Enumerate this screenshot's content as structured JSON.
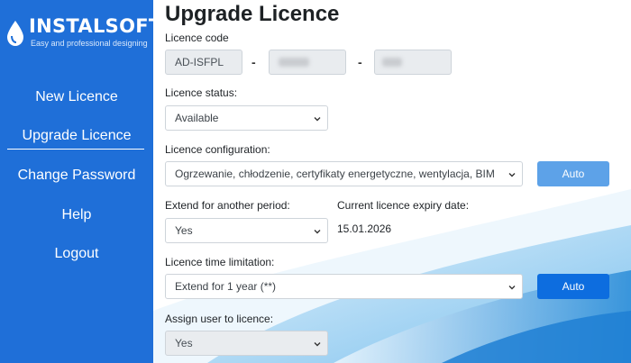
{
  "logo": {
    "title": "INSTALSOFT",
    "subtitle": "Easy and professional designing"
  },
  "sidebar": {
    "items": [
      {
        "label": "New Licence"
      },
      {
        "label": "Upgrade Licence"
      },
      {
        "label": "Change Password"
      },
      {
        "label": "Help"
      },
      {
        "label": "Logout"
      }
    ]
  },
  "page": {
    "title": "Upgrade Licence"
  },
  "licence_code": {
    "label": "Licence code",
    "part1": "AD-ISFPL",
    "separator": "-"
  },
  "licence_status": {
    "label": "Licence status:",
    "value": "Available"
  },
  "licence_configuration": {
    "label": "Licence configuration:",
    "value": "Ogrzewanie, chłodzenie, certyfikaty energetyczne, wentylacja, BIM",
    "button": "Auto"
  },
  "extend": {
    "label": "Extend for another period:",
    "value": "Yes"
  },
  "expiry": {
    "label": "Current licence expiry date:",
    "value": "15.01.2026"
  },
  "time_limitation": {
    "label": "Licence time limitation:",
    "value": "Extend for 1 year (**)",
    "button": "Auto"
  },
  "assign_user": {
    "label": "Assign user to licence:",
    "value": "Yes"
  },
  "colors": {
    "sidebar": "#1f6fd8",
    "button_light": "#5da2e8",
    "button_dark": "#0d6ddf"
  }
}
